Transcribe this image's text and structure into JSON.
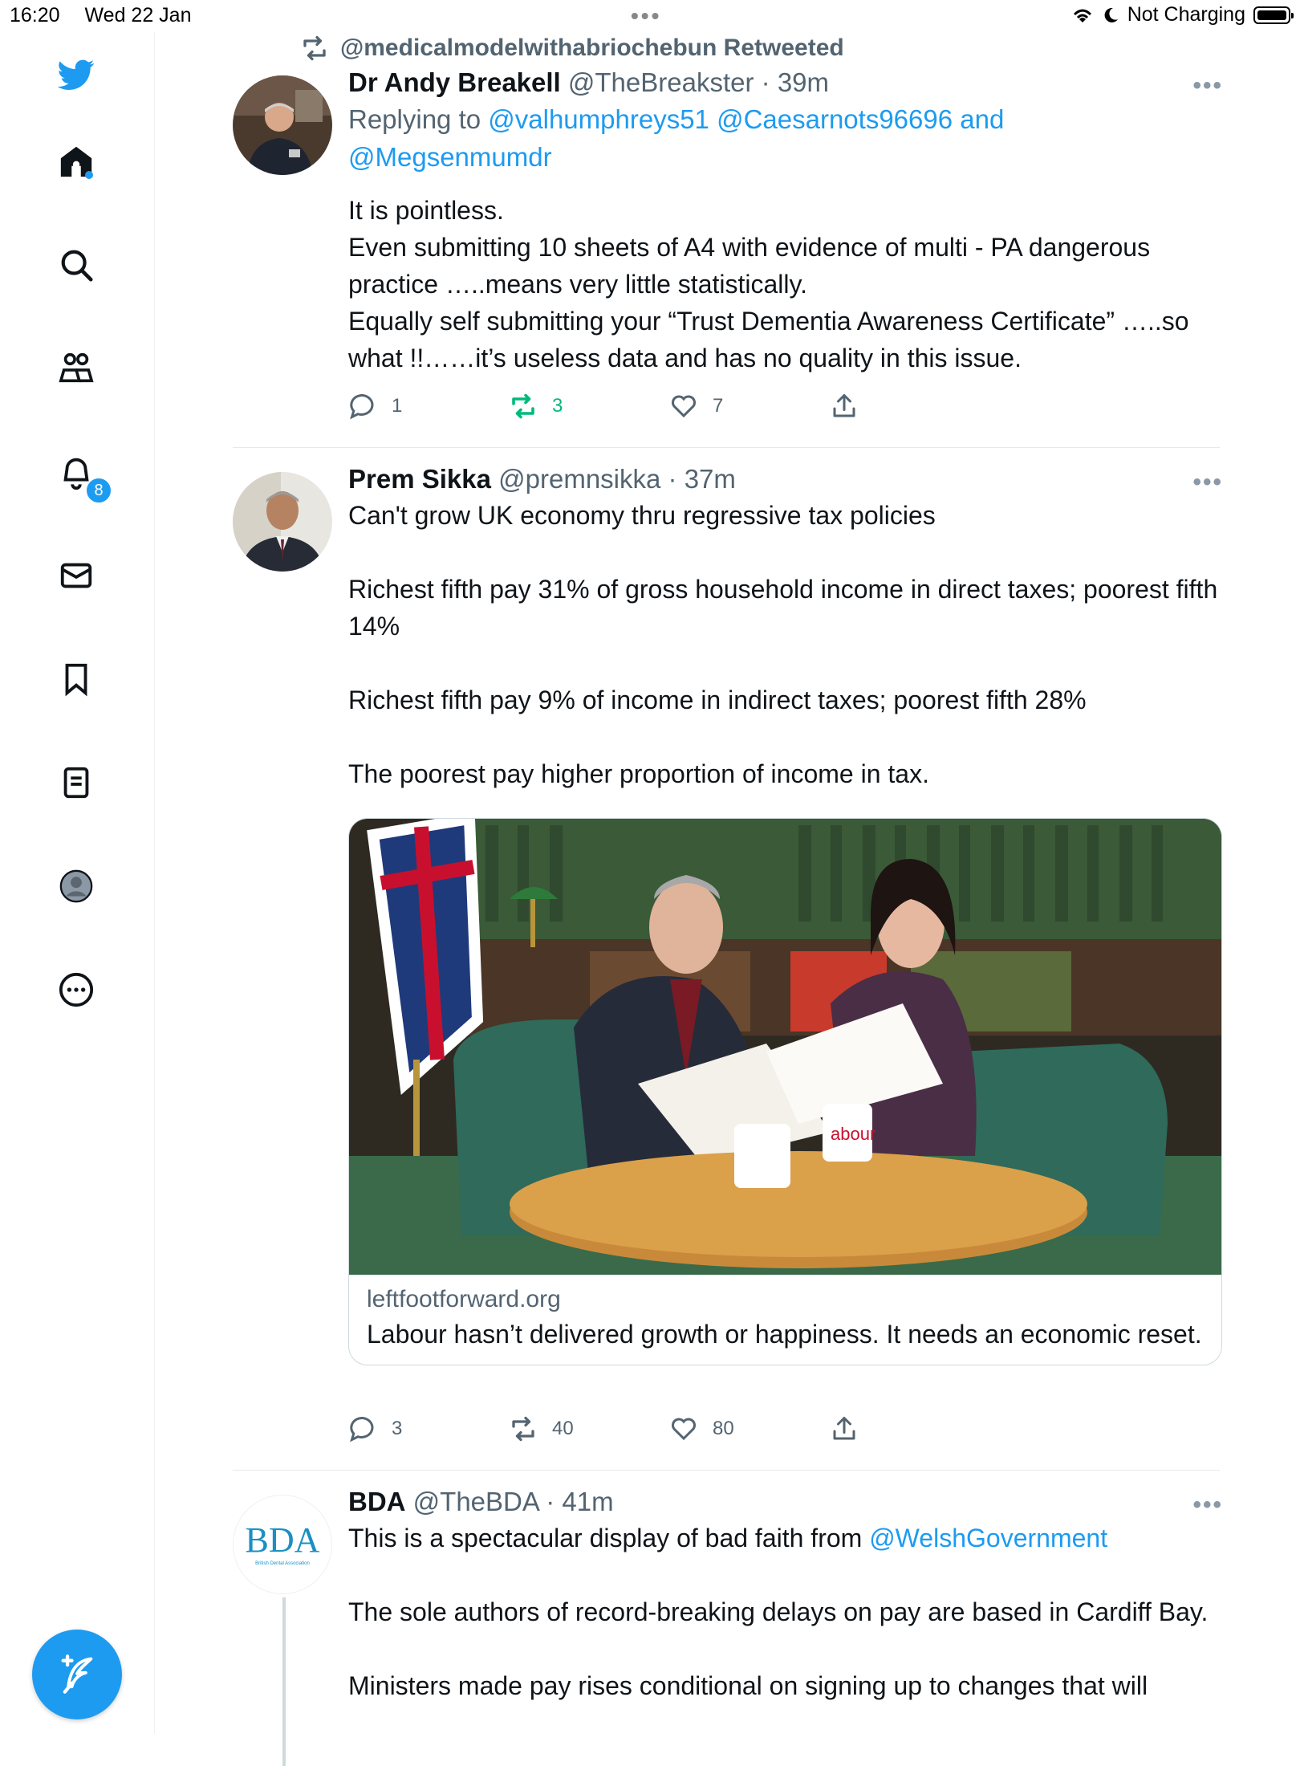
{
  "status_bar": {
    "time": "16:20",
    "date": "Wed 22 Jan",
    "charging": "Not Charging"
  },
  "sidebar": {
    "items": [
      {
        "icon": "twitter-logo-icon"
      },
      {
        "icon": "home-icon"
      },
      {
        "icon": "search-icon"
      },
      {
        "icon": "communities-icon"
      },
      {
        "icon": "notifications-icon",
        "badge": "8"
      },
      {
        "icon": "messages-icon"
      },
      {
        "icon": "bookmarks-icon"
      },
      {
        "icon": "lists-icon"
      },
      {
        "icon": "profile-icon"
      },
      {
        "icon": "more-icon"
      }
    ],
    "compose_icon": "compose-tweet-icon",
    "accent_color": "#1d9bf0"
  },
  "tweets": [
    {
      "retweeted_by": "@medicalmodelwithabriochebun Retweeted",
      "name": "Dr Andy Breakell",
      "handle": "@TheBreakster",
      "time": "· 39m",
      "replying_prefix": "Replying to ",
      "replying_line1": "@valhumphreys51 @Caesarnots96696 and",
      "replying_line2": "@Megsenmumdr",
      "text": "It is pointless.\nEven submitting 10 sheets of A4 with evidence of multi - PA dangerous practice …..means very little statistically.\nEqually self submitting your “Trust Dementia Awareness Certificate” …..so what !!……it’s useless data and has no quality in this issue.",
      "replies": "1",
      "retweets": "3",
      "likes": "7"
    },
    {
      "name": "Prem Sikka",
      "handle": "@premnsikka",
      "time": "· 37m",
      "text": "Can't grow UK economy thru regressive tax policies\n\nRichest fifth pay 31% of gross household income in direct taxes; poorest fifth 14%\n\nRichest fifth pay 9% of income in indirect taxes; poorest fifth 28%\n\nThe poorest pay higher proportion of income in tax.",
      "card_domain": "leftfootforward.org",
      "card_title": "Labour hasn’t delivered growth or happiness. It needs an economic reset.",
      "mug_text": "abour",
      "replies": "3",
      "retweets": "40",
      "likes": "80"
    },
    {
      "name": "BDA",
      "handle": "@TheBDA",
      "time": "· 41m",
      "avatar_logo": "BDA",
      "avatar_sub": "British Dental Association",
      "text_prefix": "This is a spectacular display of bad faith from ",
      "mention": "@WelshGovernment",
      "text": "The sole authors of record-breaking delays on pay are based in Cardiff Bay.",
      "text_cut": "Ministers made pay rises conditional on signing up to changes that will"
    }
  ],
  "colors": {
    "retweet_active": "#00ba7c",
    "secondary_text": "#536471"
  }
}
